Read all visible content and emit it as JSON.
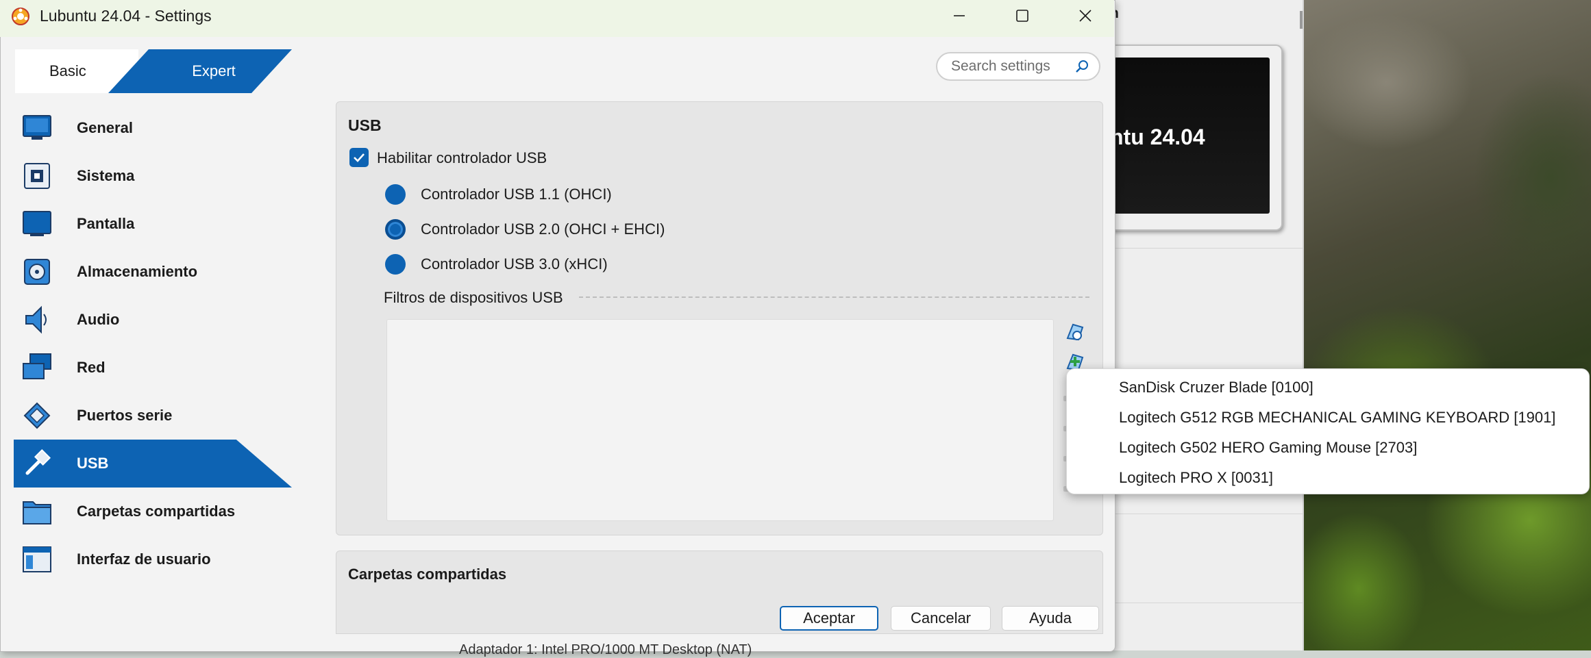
{
  "window": {
    "title": "Lubuntu 24.04 - Settings"
  },
  "mode_tabs": {
    "basic": "Basic",
    "expert": "Expert"
  },
  "search": {
    "placeholder": "Search settings"
  },
  "sidebar": {
    "items": [
      {
        "label": "General",
        "icon": "monitor-icon"
      },
      {
        "label": "Sistema",
        "icon": "chip-icon"
      },
      {
        "label": "Pantalla",
        "icon": "display-icon"
      },
      {
        "label": "Almacenamiento",
        "icon": "disk-icon"
      },
      {
        "label": "Audio",
        "icon": "speaker-icon"
      },
      {
        "label": "Red",
        "icon": "network-icon"
      },
      {
        "label": "Puertos serie",
        "icon": "serial-port-icon"
      },
      {
        "label": "USB",
        "icon": "usb-icon",
        "active": true
      },
      {
        "label": "Carpetas compartidas",
        "icon": "folder-icon"
      },
      {
        "label": "Interfaz de usuario",
        "icon": "window-icon"
      }
    ]
  },
  "usb": {
    "section_title": "USB",
    "enable_label": "Habilitar controlador USB",
    "enable_checked": true,
    "controllers": [
      {
        "label": "Controlador USB 1.1 (OHCI)",
        "selected": false
      },
      {
        "label": "Controlador USB 2.0 (OHCI + EHCI)",
        "selected": true
      },
      {
        "label": "Controlador USB 3.0 (xHCI)",
        "selected": false
      }
    ],
    "filters_label": "Filtros de dispositivos USB"
  },
  "shared_folders": {
    "section_title": "Carpetas compartidas"
  },
  "buttons": {
    "ok": "Aceptar",
    "cancel": "Cancelar",
    "help": "Ayuda"
  },
  "device_menu": {
    "items": [
      "SanDisk Cruzer Blade [0100]",
      "Logitech G512 RGB MECHANICAL GAMING KEYBOARD [1901]",
      "Logitech G502 HERO Gaming Mouse [2703]",
      "Logitech PRO X [0031]"
    ]
  },
  "background": {
    "title_fragment": "n",
    "preview_text": "ntu 24.04",
    "bottom_fragment": "Adaptador 1: Intel PRO/1000 MT Desktop (NAT)"
  },
  "colors": {
    "accent": "#0d63b3",
    "titlebar": "#eef5e6",
    "window_bg": "#f3f3f3",
    "panel_bg": "#e6e6e6"
  }
}
